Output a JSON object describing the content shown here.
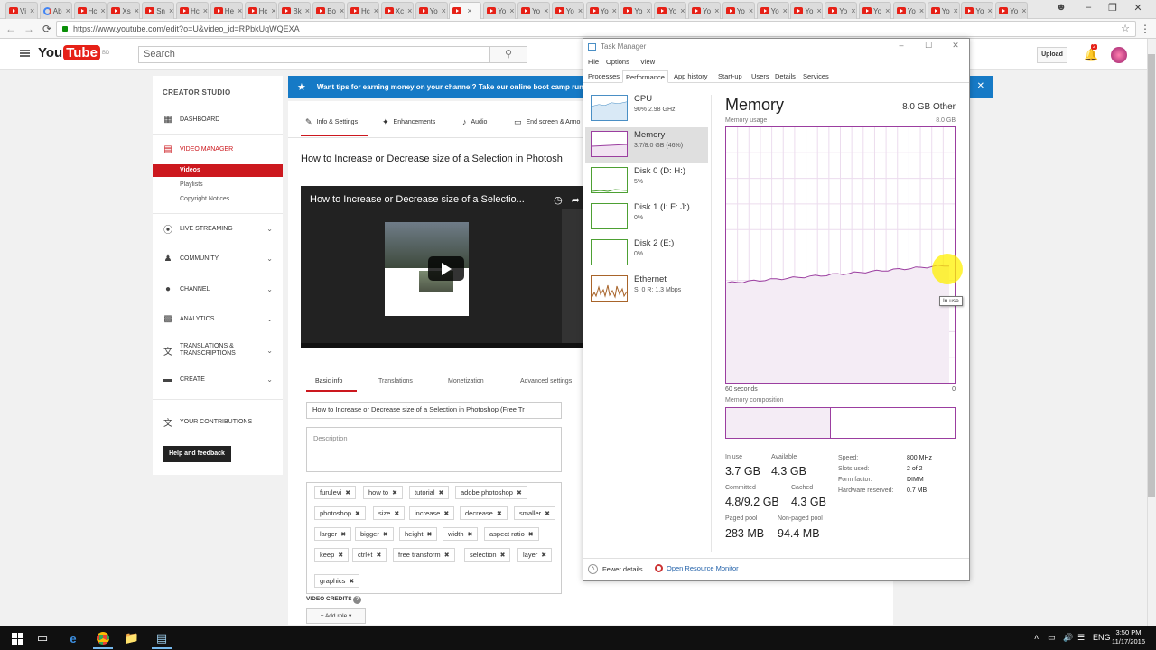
{
  "browser": {
    "tabs": [
      {
        "title": "Vi",
        "icon": "youtube-icon"
      },
      {
        "title": "Ab",
        "icon": "chrome-icon"
      },
      {
        "title": "Hc",
        "icon": "youtube-icon"
      },
      {
        "title": "Xs",
        "icon": "youtube-icon"
      },
      {
        "title": "Sn",
        "icon": "youtube-icon"
      },
      {
        "title": "Hc",
        "icon": "youtube-icon"
      },
      {
        "title": "He",
        "icon": "youtube-icon"
      },
      {
        "title": "Hc",
        "icon": "youtube-icon"
      },
      {
        "title": "Bk",
        "icon": "youtube-icon"
      },
      {
        "title": "Bo",
        "icon": "youtube-icon"
      },
      {
        "title": "Hc",
        "icon": "youtube-icon"
      },
      {
        "title": "Xc",
        "icon": "youtube-icon"
      },
      {
        "title": "Yo",
        "icon": "youtube-icon"
      },
      {
        "title": "",
        "icon": "youtube-icon",
        "active": true
      },
      {
        "title": "Yo",
        "icon": "youtube-icon"
      },
      {
        "title": "Yo",
        "icon": "youtube-icon"
      },
      {
        "title": "Yo",
        "icon": "youtube-icon"
      },
      {
        "title": "Yo",
        "icon": "youtube-icon"
      },
      {
        "title": "Yo",
        "icon": "youtube-icon"
      },
      {
        "title": "Yo",
        "icon": "youtube-icon"
      },
      {
        "title": "Yo",
        "icon": "youtube-icon"
      },
      {
        "title": "Yo",
        "icon": "youtube-icon"
      },
      {
        "title": "Yo",
        "icon": "youtube-icon"
      },
      {
        "title": "Yo",
        "icon": "youtube-icon"
      },
      {
        "title": "Yo",
        "icon": "youtube-icon"
      },
      {
        "title": "Yo",
        "icon": "youtube-icon"
      },
      {
        "title": "Yo",
        "icon": "youtube-icon"
      },
      {
        "title": "Yo",
        "icon": "youtube-icon"
      },
      {
        "title": "Yo",
        "icon": "youtube-icon"
      },
      {
        "title": "Yo",
        "icon": "youtube-icon"
      }
    ],
    "url": "https://www.youtube.com/edit?o=U&video_id=RPbkUqWQEXA"
  },
  "youtube": {
    "logo": "You",
    "logo_tube": "Tube",
    "logo_region": "BD",
    "search_placeholder": "Search",
    "upload_label": "Upload",
    "notification_count": "2"
  },
  "sidebar": {
    "title": "CREATOR STUDIO",
    "dashboard": "DASHBOARD",
    "video_manager": "VIDEO MANAGER",
    "sub": {
      "videos": "Videos",
      "playlists": "Playlists",
      "copyright": "Copyright Notices"
    },
    "live": "LIVE STREAMING",
    "community": "COMMUNITY",
    "channel": "CHANNEL",
    "analytics": "ANALYTICS",
    "translations_1": "TRANSLATIONS &",
    "translations_2": "TRANSCRIPTIONS",
    "create": "CREATE",
    "contributions": "YOUR CONTRIBUTIONS",
    "feedback": "Help and feedback"
  },
  "banner": {
    "text": "Want tips for earning money on your channel? Take our online boot camp run"
  },
  "editor": {
    "tabs": {
      "info": "Info & Settings",
      "enhancements": "Enhancements",
      "audio": "Audio",
      "endscreen": "End screen & Anno"
    },
    "title": "How to Increase or Decrease size of a Selection in Photosh",
    "player_title": "How to Increase or Decrease size of a Selectio...",
    "basic_tabs": {
      "basic": "Basic info",
      "translations": "Translations",
      "monetization": "Monetization",
      "advanced": "Advanced settings"
    },
    "title_field": "How to Increase or Decrease size of a Selection in Photoshop (Free Tr",
    "description_placeholder": "Description",
    "tags": [
      "furulevi",
      "how to",
      "tutorial",
      "adobe photoshop",
      "photoshop",
      "size",
      "increase",
      "decrease",
      "smaller",
      "larger",
      "bigger",
      "height",
      "width",
      "aspect ratio",
      "keep",
      "ctrl+t",
      "free transform",
      "selection",
      "layer",
      "graphics"
    ],
    "video_credits": "VIDEO CREDITS",
    "add_role": "Add role"
  },
  "taskmgr": {
    "title": "Task Manager",
    "menu": {
      "file": "File",
      "options": "Options",
      "view": "View"
    },
    "tabs": {
      "processes": "Processes",
      "performance": "Performance",
      "app_history": "App history",
      "startup": "Start-up",
      "users": "Users",
      "details": "Details",
      "services": "Services"
    },
    "resources": {
      "cpu": {
        "name": "CPU",
        "value": "90% 2.98 GHz"
      },
      "memory": {
        "name": "Memory",
        "value": "3.7/8.0 GB (46%)"
      },
      "disk0": {
        "name": "Disk 0 (D: H:)",
        "value": "5%"
      },
      "disk1": {
        "name": "Disk 1 (I: F: J:)",
        "value": "0%"
      },
      "disk2": {
        "name": "Disk 2 (E:)",
        "value": "0%"
      },
      "ethernet": {
        "name": "Ethernet",
        "value": "S: 0 R: 1.3 Mbps"
      }
    },
    "memory": {
      "title": "Memory",
      "total": "8.0 GB Other",
      "usage_label": "Memory usage",
      "usage_max": "8.0 GB",
      "axis_left": "60 seconds",
      "axis_right": "0",
      "tooltip": "In use",
      "usage_fraction_start": 0.39,
      "usage_fraction_end": 0.46,
      "composition_label": "Memory composition",
      "composition_in_use_fraction": 0.46,
      "in_use_label": "In use",
      "in_use": "3.7 GB",
      "available_label": "Available",
      "available": "4.3 GB",
      "committed_label": "Committed",
      "committed": "4.8/9.2 GB",
      "cached_label": "Cached",
      "cached": "4.3 GB",
      "paged_label": "Paged pool",
      "paged": "283 MB",
      "nonpaged_label": "Non-paged pool",
      "nonpaged": "94.4 MB",
      "speed_label": "Speed:",
      "speed": "800 MHz",
      "slots_label": "Slots used:",
      "slots": "2 of 2",
      "form_label": "Form factor:",
      "form": "DIMM",
      "reserved_label": "Hardware reserved:",
      "reserved": "0.7 MB"
    },
    "footer": {
      "fewer": "Fewer details",
      "monitor": "Open Resource Monitor"
    }
  },
  "taskbar": {
    "lang": "ENG",
    "time": "3:50 PM",
    "date": "11/17/2016"
  },
  "colors": {
    "youtube_red": "#e62117",
    "banner_blue": "#167ac6",
    "memory_purple": "#9b3ea0",
    "selected_red": "#cc181e"
  }
}
